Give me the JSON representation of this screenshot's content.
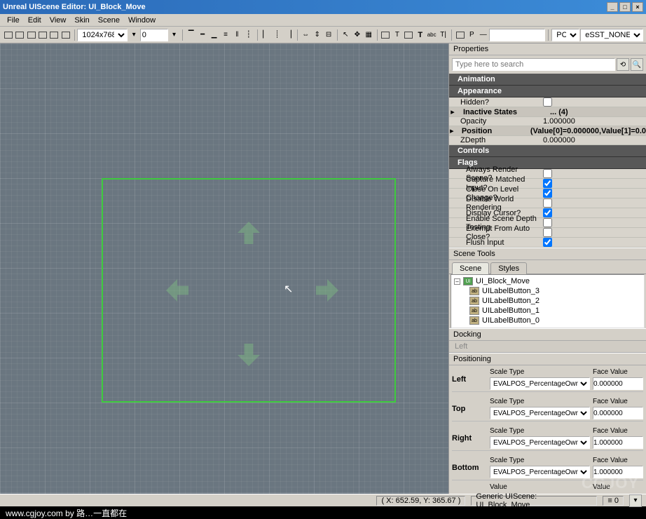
{
  "title": "Unreal UIScene Editor: UI_Block_Move",
  "menu": [
    "File",
    "Edit",
    "View",
    "Skin",
    "Scene",
    "Window"
  ],
  "toolbar": {
    "resolution_options": [
      "1024x768"
    ],
    "resolution_value": "1024x768",
    "num_value": "0",
    "platform": "PC",
    "sst": "eSST_NONE"
  },
  "properties": {
    "title": "Properties",
    "search_placeholder": "Type here to search",
    "sections": {
      "animation": "Animation",
      "appearance": "Appearance",
      "controls": "Controls",
      "flags": "Flags"
    },
    "appearance_rows": [
      {
        "label": "Hidden?",
        "type": "check",
        "value": false
      },
      {
        "label": "Inactive States",
        "type": "expand",
        "value": "... (4)"
      },
      {
        "label": "Opacity",
        "type": "text",
        "value": "1.000000"
      },
      {
        "label": "Position",
        "type": "expand",
        "value": "(Value[0]=0.000000,Value[1]=0.0"
      },
      {
        "label": "ZDepth",
        "type": "text",
        "value": "0.000000"
      }
    ],
    "flag_rows": [
      {
        "label": "Always Render Scene?",
        "value": false
      },
      {
        "label": "Capture Matched Input?",
        "value": true
      },
      {
        "label": "Close On Level Change?",
        "value": true
      },
      {
        "label": "Disable World Rendering",
        "value": false
      },
      {
        "label": "Display Cursor?",
        "value": true
      },
      {
        "label": "Enable Scene Depth Testing",
        "value": false
      },
      {
        "label": "Exempt From Auto Close?",
        "value": false
      },
      {
        "label": "Flush Input",
        "value": true
      }
    ]
  },
  "scene_tools": {
    "title": "Scene Tools",
    "tabs": [
      "Scene",
      "Styles"
    ],
    "tree_root": "UI_Block_Move",
    "tree_children": [
      "UILabelButton_3",
      "UILabelButton_2",
      "UILabelButton_1",
      "UILabelButton_0"
    ]
  },
  "docking": {
    "title": "Docking",
    "value": "Left"
  },
  "positioning": {
    "title": "Positioning",
    "scale_label": "Scale Type",
    "face_label": "Face Value",
    "scale_option": "EVALPOS_PercentageOwner",
    "rows": [
      {
        "side": "Left",
        "value": "0.000000"
      },
      {
        "side": "Top",
        "value": "0.000000"
      },
      {
        "side": "Right",
        "value": "1.000000"
      },
      {
        "side": "Bottom",
        "value": "1.000000"
      }
    ],
    "footer_labels": [
      "Value",
      "Value"
    ]
  },
  "status": {
    "coords": "( X: 652.59, Y: 365.67 )",
    "scene": "Generic UIScene: UI_Block_Move",
    "count_prefix": "≡",
    "count": "0"
  },
  "footer": "www.cgjoy.com by 路…一直都在",
  "watermark": "CGJOY"
}
